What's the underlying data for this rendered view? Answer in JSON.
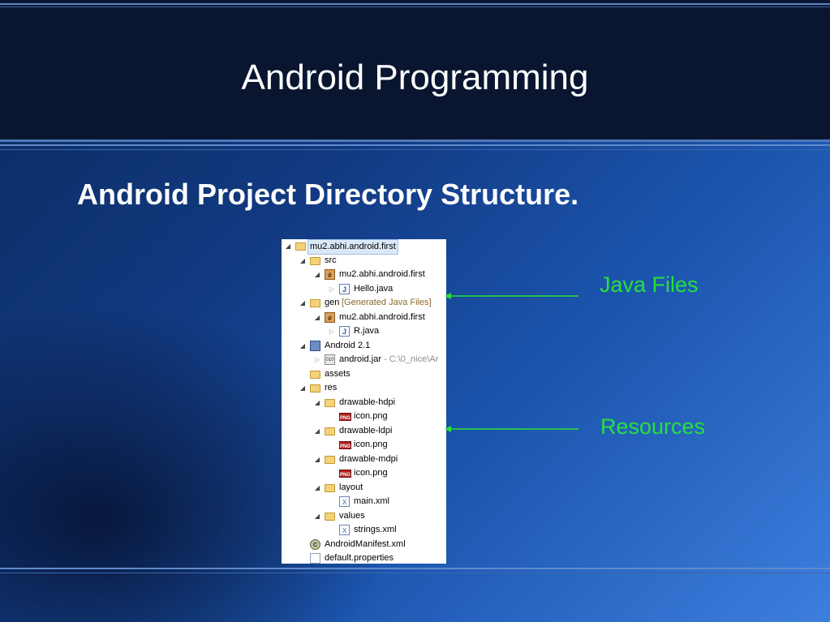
{
  "slide": {
    "title": "Android Programming",
    "subtitle": "Android Project Directory Structure.",
    "accent_color": "#27e03a"
  },
  "tree": [
    {
      "depth": 0,
      "expand": "open",
      "icon": "project",
      "icon_name": "android-project-icon",
      "label": "mu2.abhi.android.first",
      "hint": "",
      "selected": true
    },
    {
      "depth": 1,
      "expand": "open",
      "icon": "srcfolder",
      "icon_name": "source-folder-icon",
      "label": "src",
      "hint": ""
    },
    {
      "depth": 2,
      "expand": "open",
      "icon": "package",
      "icon_name": "package-icon",
      "label": "mu2.abhi.android.first",
      "hint": ""
    },
    {
      "depth": 3,
      "expand": "closed",
      "icon": "java",
      "icon_name": "java-file-icon",
      "label": "Hello.java",
      "hint": ""
    },
    {
      "depth": 1,
      "expand": "open",
      "icon": "srcfolder",
      "icon_name": "generated-folder-icon",
      "label": "gen",
      "hint": "[Generated Java Files]"
    },
    {
      "depth": 2,
      "expand": "open",
      "icon": "package",
      "icon_name": "package-icon",
      "label": "mu2.abhi.android.first",
      "hint": ""
    },
    {
      "depth": 3,
      "expand": "closed",
      "icon": "java",
      "icon_name": "java-file-icon",
      "label": "R.java",
      "hint": ""
    },
    {
      "depth": 1,
      "expand": "open",
      "icon": "lib",
      "icon_name": "library-icon",
      "label": "Android 2.1",
      "hint": ""
    },
    {
      "depth": 2,
      "expand": "closed",
      "icon": "jar",
      "icon_name": "jar-icon",
      "label": "android.jar",
      "hint": "- C:\\0_nice\\Ar"
    },
    {
      "depth": 1,
      "expand": "none",
      "icon": "folder",
      "icon_name": "folder-icon",
      "label": "assets",
      "hint": ""
    },
    {
      "depth": 1,
      "expand": "open",
      "icon": "folder",
      "icon_name": "folder-icon",
      "label": "res",
      "hint": ""
    },
    {
      "depth": 2,
      "expand": "open",
      "icon": "folder",
      "icon_name": "folder-icon",
      "label": "drawable-hdpi",
      "hint": ""
    },
    {
      "depth": 3,
      "expand": "none",
      "icon": "png",
      "icon_name": "png-file-icon",
      "label": "icon.png",
      "hint": ""
    },
    {
      "depth": 2,
      "expand": "open",
      "icon": "folder",
      "icon_name": "folder-icon",
      "label": "drawable-ldpi",
      "hint": ""
    },
    {
      "depth": 3,
      "expand": "none",
      "icon": "png",
      "icon_name": "png-file-icon",
      "label": "icon.png",
      "hint": ""
    },
    {
      "depth": 2,
      "expand": "open",
      "icon": "folder",
      "icon_name": "folder-icon",
      "label": "drawable-mdpi",
      "hint": ""
    },
    {
      "depth": 3,
      "expand": "none",
      "icon": "png",
      "icon_name": "png-file-icon",
      "label": "icon.png",
      "hint": ""
    },
    {
      "depth": 2,
      "expand": "open",
      "icon": "folder",
      "icon_name": "folder-icon",
      "label": "layout",
      "hint": ""
    },
    {
      "depth": 3,
      "expand": "none",
      "icon": "xml",
      "icon_name": "xml-file-icon",
      "label": "main.xml",
      "hint": ""
    },
    {
      "depth": 2,
      "expand": "open",
      "icon": "folder",
      "icon_name": "folder-icon",
      "label": "values",
      "hint": ""
    },
    {
      "depth": 3,
      "expand": "none",
      "icon": "xml",
      "icon_name": "xml-file-icon",
      "label": "strings.xml",
      "hint": ""
    },
    {
      "depth": 1,
      "expand": "none",
      "icon": "manifest",
      "icon_name": "manifest-file-icon",
      "label": "AndroidManifest.xml",
      "hint": ""
    },
    {
      "depth": 1,
      "expand": "none",
      "icon": "props",
      "icon_name": "properties-file-icon",
      "label": "default.properties",
      "hint": ""
    }
  ],
  "callouts": {
    "java_files": "Java Files",
    "resources": "Resources"
  }
}
